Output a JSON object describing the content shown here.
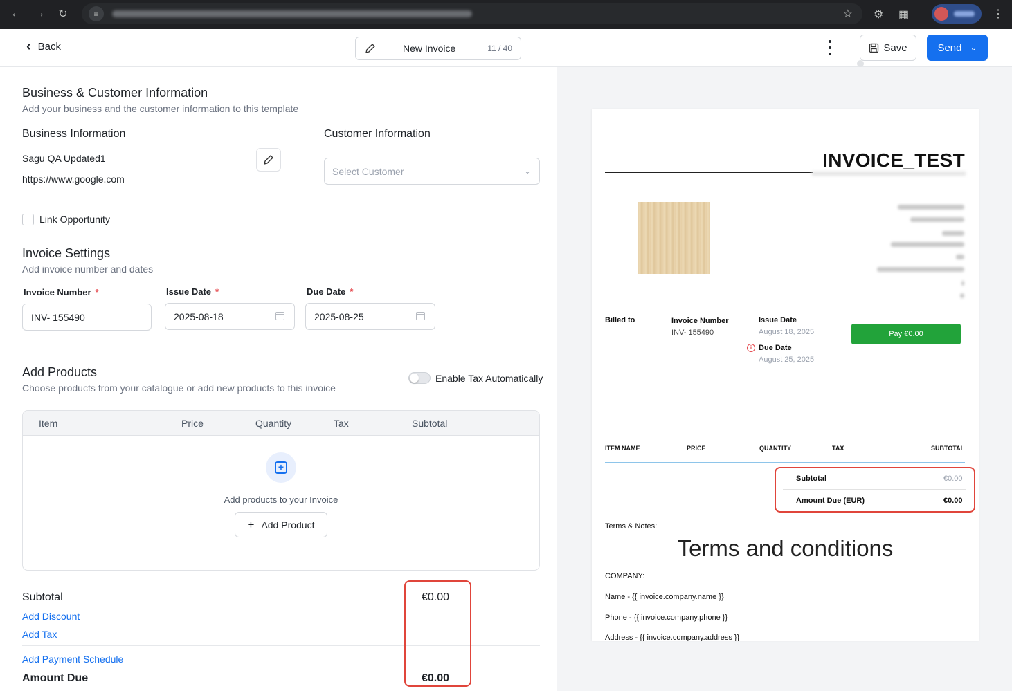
{
  "header": {
    "back_label": "Back",
    "title": "New Invoice",
    "title_count": "11 / 40",
    "save_label": "Save",
    "send_label": "Send"
  },
  "business_customer": {
    "title": "Business & Customer Information",
    "subtitle": "Add your business and the customer information to this template",
    "business_heading": "Business Information",
    "business_name": "Sagu QA Updated1",
    "business_url": "https://www.google.com",
    "customer_heading": "Customer Information",
    "customer_placeholder": "Select Customer",
    "link_opportunity_label": "Link Opportunity"
  },
  "invoice_settings": {
    "title": "Invoice Settings",
    "subtitle": "Add invoice number and dates",
    "invoice_number_label": "Invoice Number",
    "invoice_number_value": "INV- 155490",
    "issue_date_label": "Issue Date",
    "issue_date_value": "2025-08-18",
    "due_date_label": "Due Date",
    "due_date_value": "2025-08-25",
    "required_mark": "*"
  },
  "products": {
    "title": "Add Products",
    "subtitle": "Choose products from your catalogue or add new products to this invoice",
    "tax_toggle_label": "Enable Tax Automatically",
    "tax_toggle_on": false,
    "columns": [
      "Item",
      "Price",
      "Quantity",
      "Tax",
      "Subtotal"
    ],
    "empty_text": "Add products to your Invoice",
    "add_product_label": "Add Product"
  },
  "totals": {
    "subtotal_label": "Subtotal",
    "subtotal_value": "€0.00",
    "add_discount_label": "Add Discount",
    "add_tax_label": "Add Tax",
    "add_payment_schedule_label": "Add Payment Schedule",
    "amount_due_label": "Amount Due",
    "amount_due_value": "€0.00"
  },
  "preview": {
    "invoice_title": "INVOICE_TEST",
    "billed_to_label": "Billed to",
    "invoice_number_label": "Invoice Number",
    "invoice_number_value": "INV- 155490",
    "issue_date_label": "Issue Date",
    "issue_date_value": "August 18, 2025",
    "due_date_label": "Due Date",
    "due_date_value": "August 25, 2025",
    "pay_button_label": "Pay €0.00",
    "columns": [
      "ITEM NAME",
      "PRICE",
      "QUANTITY",
      "TAX",
      "SUBTOTAL"
    ],
    "subtotal_label": "Subtotal",
    "subtotal_value": "€0.00",
    "amount_due_label": "Amount Due (EUR)",
    "amount_due_value": "€0.00",
    "terms_label": "Terms & Notes:",
    "terms_heading": "Terms and conditions",
    "company_label": "COMPANY:",
    "company_name_line": "Name - {{ invoice.company.name }}",
    "company_phone_line": "Phone - {{ invoice.company.phone }}",
    "company_address_line": "Address - {{ invoice.company.address }}"
  },
  "colors": {
    "primary": "#1570ef",
    "pay_green": "#22a33a",
    "highlight_red": "#e0453b"
  }
}
